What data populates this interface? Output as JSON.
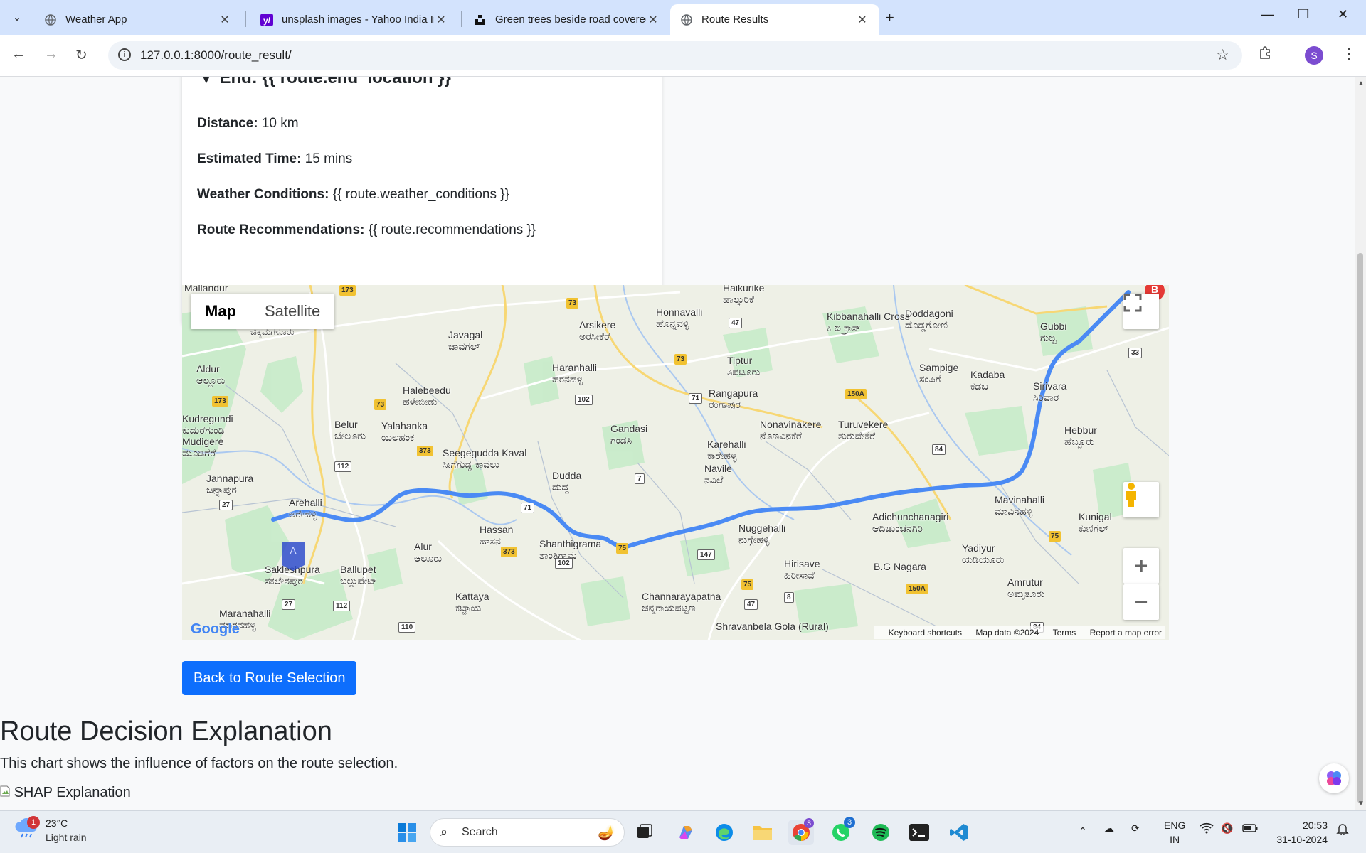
{
  "browser": {
    "tabs": [
      {
        "title": "Weather App",
        "active": false
      },
      {
        "title": "unsplash images - Yahoo India Image Search",
        "active": false
      },
      {
        "title": "Green trees beside road covered",
        "active": false
      },
      {
        "title": "Route Results",
        "active": true
      }
    ],
    "url": "127.0.0.1:8000/route_result/",
    "profile_initial": "S"
  },
  "route": {
    "end_label": "End:",
    "end_value": "{{ route.end_location }}",
    "distance_label": "Distance:",
    "distance_value": "10 km",
    "time_label": "Estimated Time:",
    "time_value": "15 mins",
    "weather_label": "Weather Conditions:",
    "weather_value": "{{ route.weather_conditions }}",
    "recommend_label": "Route Recommendations:",
    "recommend_value": "{{ route.recommendations }}"
  },
  "map": {
    "type_map": "Map",
    "type_satellite": "Satellite",
    "marker_start": "A",
    "marker_end": "B",
    "footer": {
      "shortcuts": "Keyboard shortcuts",
      "data": "Map data ©2024",
      "terms": "Terms",
      "report": "Report a map error"
    },
    "logo": "Google",
    "places": [
      {
        "en": "Mallandur"
      },
      {
        "en": "Chikkamagaluru",
        "kn": "ಚಿಕ್ಕಮಗಳೂರು"
      },
      {
        "en": "Aldur",
        "kn": "ಆಲ್ದೂರು"
      },
      {
        "en": "Kudregundi",
        "kn": "ಕುದುರೆಗುಂಡಿ"
      },
      {
        "en": "Mudigere",
        "kn": "ಮೂಡಿಗೆರೆ"
      },
      {
        "en": "Jannapura",
        "kn": "ಜನ್ನಾಪುರ"
      },
      {
        "en": "Arehalli",
        "kn": "ಅರೇಹಳ್ಳಿ"
      },
      {
        "en": "Sakleshpura",
        "kn": "ಸಕಲೇಶಪುರ"
      },
      {
        "en": "Ballupet",
        "kn": "ಬಲ್ಲುಪೇಟ್"
      },
      {
        "en": "Maranahalli",
        "kn": "ಮಾರನಹಳ್ಳಿ"
      },
      {
        "en": "Belur",
        "kn": "ಬೇಲೂರು"
      },
      {
        "en": "Halebeedu",
        "kn": "ಹಳೇಬೀಡು"
      },
      {
        "en": "Yalahanka",
        "kn": "ಯಲಹಂಕ"
      },
      {
        "en": "Javagal",
        "kn": "ಜಾವಗಲ್"
      },
      {
        "en": "Seegegudda Kaval",
        "kn": "ಸೀಗೆಗುಡ್ಡ ಕಾವಲು"
      },
      {
        "en": "Alur",
        "kn": "ಆಲೂರು"
      },
      {
        "en": "Hassan",
        "kn": "ಹಾಸನ"
      },
      {
        "en": "Kattaya",
        "kn": "ಕಟ್ಟಾಯ"
      },
      {
        "en": "Arsikere",
        "kn": "ಅರಸೀಕೆರೆ"
      },
      {
        "en": "Haranhalli",
        "kn": "ಹರನಹಳ್ಳಿ"
      },
      {
        "en": "Gandasi",
        "kn": "ಗಂಡಸಿ"
      },
      {
        "en": "Dudda",
        "kn": "ದುದ್ದ"
      },
      {
        "en": "Shanthigrama",
        "kn": "ಶಾಂತಿಗ್ರಾಮ"
      },
      {
        "en": "Haikurike",
        "kn": "ಹಾಲ್ಕುರಿಕೆ"
      },
      {
        "en": "Honnavalli",
        "kn": "ಹೊನ್ನವಳ್ಳಿ"
      },
      {
        "en": "Tiptur",
        "kn": "ತಿಪಟೂರು"
      },
      {
        "en": "Rangapura",
        "kn": "ರಂಗಾಪುರ"
      },
      {
        "en": "Karehalli",
        "kn": "ಕಾರೇಹಳ್ಳಿ"
      },
      {
        "en": "Navile",
        "kn": "ನವಿಲೆ"
      },
      {
        "en": "Nuggehalli",
        "kn": "ನುಗ್ಗೇಹಳ್ಳಿ"
      },
      {
        "en": "Channarayapatna",
        "kn": "ಚನ್ನರಾಯಪಟ್ಟಣ"
      },
      {
        "en": "Shravanbela Gola (Rural)"
      },
      {
        "en": "Hirisave",
        "kn": "ಹಿರೀಸಾವೆ"
      },
      {
        "en": "Nonavinakere",
        "kn": "ನೊಣವಿನಕೆರೆ"
      },
      {
        "en": "Turuvekere",
        "kn": "ತುರುವೇಕೆರೆ"
      },
      {
        "en": "Kibbanahalli Cross",
        "kn": "ಕಿ ಬಿ ಕ್ರಾಸ್"
      },
      {
        "en": "Doddagoni",
        "kn": "ದೊಡ್ಡಗೋಣಿ"
      },
      {
        "en": "Sampige",
        "kn": "ಸಂಪಿಗೆ"
      },
      {
        "en": "Kadaba",
        "kn": "ಕಡಬ"
      },
      {
        "en": "Gubbi",
        "kn": "ಗುಬ್ಬಿ"
      },
      {
        "en": "Sirivara",
        "kn": "ಸಿರಿವಾರ"
      },
      {
        "en": "Hebbur",
        "kn": "ಹೆಬ್ಬೂರು"
      },
      {
        "en": "Adichunchanagiri",
        "kn": "ಆದಿಚುಂಚನಗಿರಿ"
      },
      {
        "en": "B.G Nagara"
      },
      {
        "en": "Yadiyur",
        "kn": "ಯಡಿಯೂರು"
      },
      {
        "en": "Mavinahalli",
        "kn": "ಮಾವಿನಹಳ್ಳಿ"
      },
      {
        "en": "Kunigal",
        "kn": "ಕುಣಿಗಲ್"
      },
      {
        "en": "Amrutur",
        "kn": "ಅಮೃತೂರು"
      }
    ],
    "highway_shields": [
      "173",
      "73",
      "47",
      "73",
      "73",
      "102",
      "71",
      "150A",
      "173",
      "373",
      "112",
      "27",
      "71",
      "7",
      "373",
      "102",
      "75",
      "147",
      "75",
      "47",
      "8",
      "150A",
      "84",
      "75",
      "33",
      "27",
      "112",
      "110",
      "84"
    ]
  },
  "page": {
    "back_button": "Back to Route Selection",
    "explanation_title": "Route Decision Explanation",
    "explanation_text": "This chart shows the influence of factors on the route selection.",
    "shap_alt": "SHAP Explanation"
  },
  "taskbar": {
    "weather_temp": "23°C",
    "weather_cond": "Light rain",
    "weather_badge": "1",
    "search_placeholder": "Search",
    "whatsapp_badge": "3",
    "lang_top": "ENG",
    "lang_bottom": "IN",
    "time": "20:53",
    "date": "31-10-2024"
  },
  "colors": {
    "route": "#4a8af4",
    "button": "#0d6efd",
    "tab_strip": "#d3e3fd"
  }
}
